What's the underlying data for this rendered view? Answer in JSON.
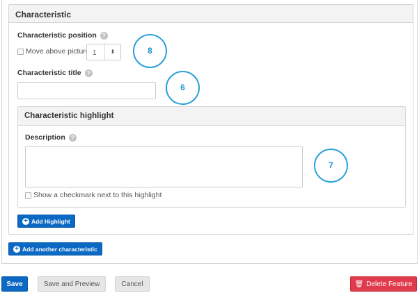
{
  "characteristic": {
    "title": "Characteristic",
    "position_label": "Characteristic position",
    "move_above_label": "Move above picture",
    "position_value": "1",
    "spinner_arrows": "⬍",
    "title_label": "Characteristic title",
    "title_value": ""
  },
  "highlight": {
    "title": "Characteristic highlight",
    "description_label": "Description",
    "description_value": "",
    "checkmark_label": "Show a checkmark next to this highlight"
  },
  "help_glyph": "?",
  "callouts": [
    "8",
    "6",
    "7"
  ],
  "buttons": {
    "add_highlight": "Add Highlight",
    "add_characteristic": "Add another characteristic",
    "save": "Save",
    "save_preview": "Save and Preview",
    "cancel": "Cancel",
    "delete": "Delete Feature"
  },
  "icons": {
    "plus": "+",
    "trash": "🗑"
  },
  "colors": {
    "primary": "#0b69c4",
    "danger": "#e03b4c",
    "callout": "#29a0d8"
  }
}
